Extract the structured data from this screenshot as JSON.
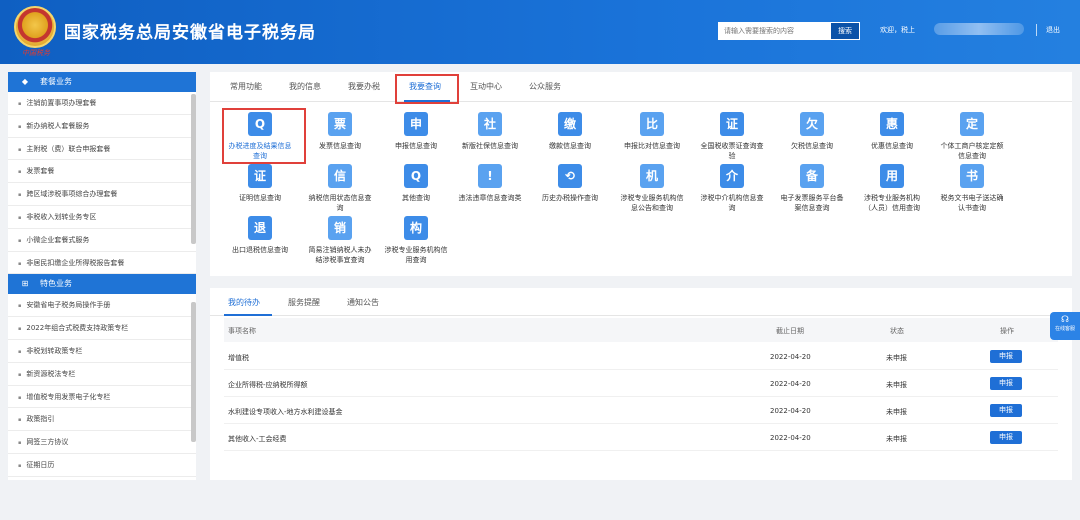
{
  "header": {
    "emblem_caption": "中国税务",
    "title": "国家税务总局安徽省电子税务局",
    "search_placeholder": "请输入需要搜索的内容",
    "search_button": "搜索",
    "welcome": "欢迎，税上",
    "logout": "退出"
  },
  "sidebar": {
    "section1": {
      "title": "套餐业务",
      "icon": "cube-icon",
      "items": [
        "注销前置事项办理套餐",
        "新办纳税人套餐服务",
        "主附税（费）联合申报套餐",
        "发票套餐",
        "跨区域涉税事项综合办理套餐",
        "非税收入划转业务专区",
        "小微企业套餐式服务",
        "非居民扣缴企业所得税报告套餐"
      ]
    },
    "section2": {
      "title": "特色业务",
      "icon": "grid-icon",
      "items": [
        "安徽省电子税务局操作手册",
        "2022年组合式税费支持政策专栏",
        "非税划转政策专栏",
        "新资源税法专栏",
        "增值税专用发票电子化专栏",
        "政策指引",
        "网签三方协议",
        "征期日历"
      ]
    }
  },
  "tabs": [
    "常用功能",
    "我的信息",
    "我要办税",
    "我要查询",
    "互动中心",
    "公众服务"
  ],
  "active_tab": "我要查询",
  "query_items": [
    {
      "label": "办税进度及结果信息查询",
      "glyph": "Q"
    },
    {
      "label": "发票信息查询",
      "glyph": "票"
    },
    {
      "label": "申报信息查询",
      "glyph": "申"
    },
    {
      "label": "新版社保信息查询",
      "glyph": "社"
    },
    {
      "label": "缴款信息查询",
      "glyph": "缴"
    },
    {
      "label": "申报比对信息查询",
      "glyph": "比"
    },
    {
      "label": "全国税收票证查询查验",
      "glyph": "证"
    },
    {
      "label": "欠税信息查询",
      "glyph": "欠"
    },
    {
      "label": "优惠信息查询",
      "glyph": "惠"
    },
    {
      "label": "个体工商户核定定额信息查询",
      "glyph": "定"
    },
    {
      "label": "证明信息查询",
      "glyph": "证"
    },
    {
      "label": "纳税信用状态信息查询",
      "glyph": "信"
    },
    {
      "label": "其他查询",
      "glyph": "Q"
    },
    {
      "label": "违法违章信息查询类",
      "glyph": "!"
    },
    {
      "label": "历史办税操作查询",
      "glyph": "⟲"
    },
    {
      "label": "涉税专业服务机构信息公告和查询",
      "glyph": "机"
    },
    {
      "label": "涉税中介机构信息查询",
      "glyph": "介"
    },
    {
      "label": "电子发票服务平台备案信息查询",
      "glyph": "备"
    },
    {
      "label": "涉税专业服务机构（人员）信用查询",
      "glyph": "用"
    },
    {
      "label": "税务文书电子送达确认书查询",
      "glyph": "书"
    },
    {
      "label": "出口退税信息查询",
      "glyph": "退"
    },
    {
      "label": "简易注销纳税人未办结涉税事宜查询",
      "glyph": "销"
    },
    {
      "label": "涉税专业服务机构信用查询",
      "glyph": "构"
    }
  ],
  "todo": {
    "tabs": [
      "我的待办",
      "服务提醒",
      "通知公告"
    ],
    "headers": {
      "name": "事项名称",
      "deadline": "截止日期",
      "status": "状态",
      "action": "操作"
    },
    "rows": [
      {
        "name": "增值税",
        "deadline": "2022-04-20",
        "status": "未申报",
        "action": "申报"
      },
      {
        "name": "企业所得税-应纳税所得额",
        "deadline": "2022-04-20",
        "status": "未申报",
        "action": "申报"
      },
      {
        "name": "水利建设专项收入-地方水利建设基金",
        "deadline": "2022-04-20",
        "status": "未申报",
        "action": "申报"
      },
      {
        "name": "其他收入-工会经费",
        "deadline": "2022-04-20",
        "status": "未申报",
        "action": "申报"
      }
    ]
  },
  "float_button": {
    "label": "在线客服",
    "icon": "headset-icon"
  },
  "colors": {
    "brand": "#1a73d9",
    "highlight_box": "#e0403a"
  }
}
